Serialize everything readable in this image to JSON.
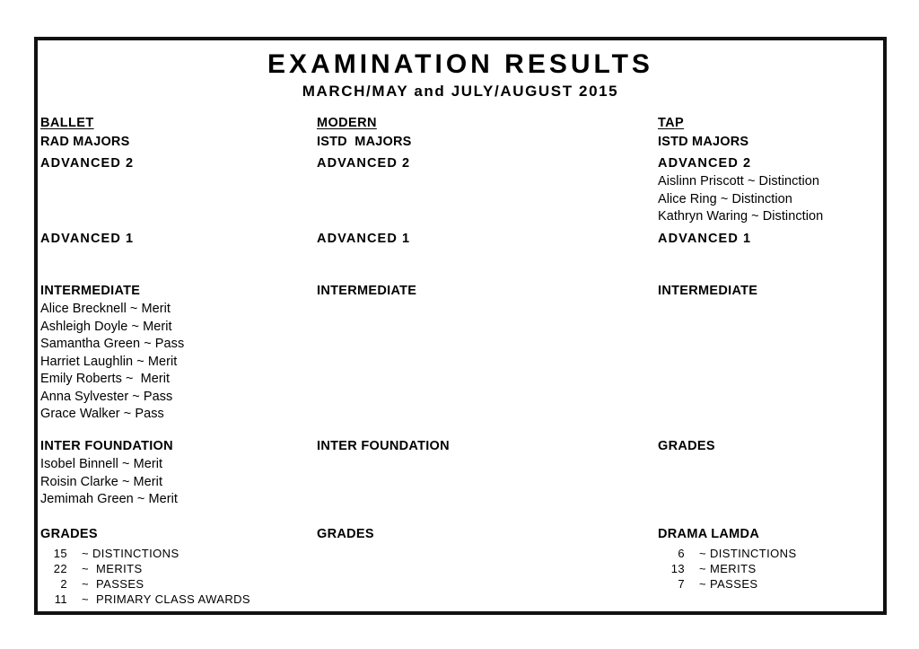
{
  "header": {
    "title": "EXAMINATION RESULTS",
    "subtitle": "MARCH/MAY and JULY/AUGUST 2015"
  },
  "colors": {
    "border": "#111111",
    "text": "#000000",
    "background": "#ffffff"
  },
  "columns": [
    {
      "discipline": "BALLET",
      "board": "RAD MAJORS",
      "sections": [
        {
          "heading": "ADVANCED 2",
          "entries": []
        },
        {
          "heading": "ADVANCED 1",
          "entries": []
        },
        {
          "heading": "INTERMEDIATE",
          "entries": [
            "Alice Brecknell ~ Merit",
            "Ashleigh Doyle ~ Merit",
            "Samantha Green ~ Pass",
            "Harriet Laughlin ~ Merit",
            "Emily Roberts ~  Merit",
            "Anna Sylvester ~ Pass",
            "Grace Walker ~ Pass"
          ]
        },
        {
          "heading": "INTER FOUNDATION",
          "entries": [
            "Isobel Binnell ~ Merit",
            "Roisin Clarke ~ Merit",
            "Jemimah Green ~ Merit"
          ]
        }
      ],
      "grades": {
        "heading": "GRADES",
        "rows": [
          {
            "count": "15",
            "label": "~ DISTINCTIONS"
          },
          {
            "count": "22",
            "label": "~  MERITS"
          },
          {
            "count": "2",
            "label": "~  PASSES"
          },
          {
            "count": "11",
            "label": "~  PRIMARY CLASS AWARDS"
          }
        ]
      }
    },
    {
      "discipline": "MODERN",
      "board": "ISTD  MAJORS",
      "sections": [
        {
          "heading": "ADVANCED 2",
          "entries": []
        },
        {
          "heading": "ADVANCED 1",
          "entries": []
        },
        {
          "heading": "INTERMEDIATE",
          "entries": []
        },
        {
          "heading": "INTER FOUNDATION",
          "entries": []
        }
      ],
      "grades": {
        "heading": "GRADES",
        "rows": []
      }
    },
    {
      "discipline": "TAP",
      "board": "ISTD MAJORS",
      "sections": [
        {
          "heading": "ADVANCED 2",
          "entries": [
            "Aislinn Priscott ~ Distinction",
            "Alice Ring ~ Distinction",
            "Kathryn Waring ~ Distinction"
          ]
        },
        {
          "heading": "ADVANCED 1",
          "entries": []
        },
        {
          "heading": "INTERMEDIATE",
          "entries": []
        },
        {
          "heading": "GRADES",
          "entries": []
        }
      ],
      "grades": {
        "heading": "DRAMA LAMDA",
        "rows": [
          {
            "count": "6",
            "label": "~ DISTINCTIONS"
          },
          {
            "count": "13",
            "label": "~ MERITS"
          },
          {
            "count": "7",
            "label": "~ PASSES"
          }
        ]
      }
    }
  ]
}
